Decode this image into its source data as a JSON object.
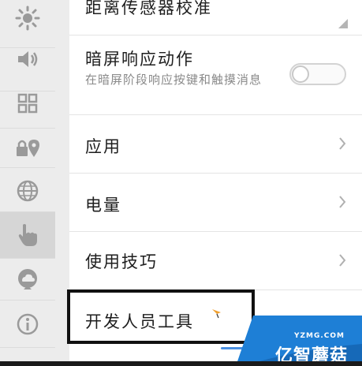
{
  "rail": {
    "items": [
      {
        "icon": "brightness-icon"
      },
      {
        "icon": "volume-icon"
      },
      {
        "icon": "grid-icon"
      },
      {
        "icon": "lock-location-icon"
      },
      {
        "icon": "globe-icon"
      },
      {
        "icon": "hand-pointer-icon",
        "active": true
      },
      {
        "icon": "cloud-sync-icon"
      },
      {
        "icon": "info-icon"
      }
    ]
  },
  "settings": {
    "proximity_calibration": {
      "title": "距离传感器校准"
    },
    "dark_screen_response": {
      "title": "暗屏响应动作",
      "subtitle": "在暗屏阶段响应按键和触摸消息",
      "enabled": false
    },
    "apps": {
      "title": "应用"
    },
    "battery": {
      "title": "电量"
    },
    "tips": {
      "title": "使用技巧"
    },
    "developer_tools": {
      "title": "开发人员工具"
    }
  },
  "watermark": {
    "url": "YZMG.COM",
    "text": "亿智蘑菇"
  },
  "colors": {
    "rail_bg": "#ececec",
    "rail_active": "#d6d6d6",
    "icon": "#9a9a9a",
    "panel_bg": "#ffffff",
    "accent_blue": "#4a90e2",
    "watermark_bg": "#1e7fd6"
  }
}
